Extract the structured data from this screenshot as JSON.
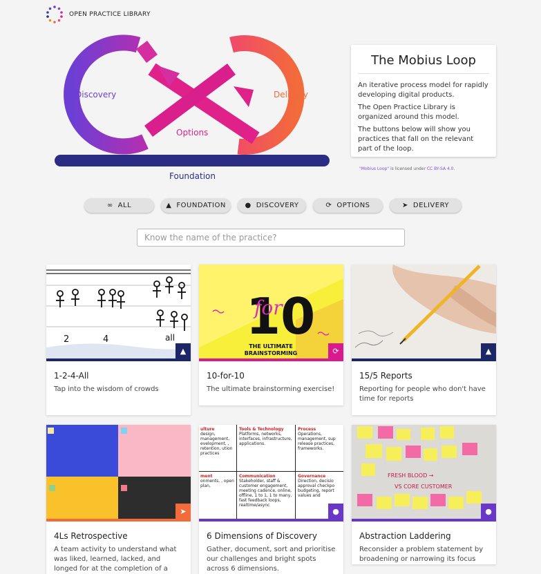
{
  "header": {
    "brand": "OPEN PRACTICE LIBRARY"
  },
  "loop": {
    "discovery_label": "Discovery",
    "delivery_label": "Delivery",
    "options_label": "Options",
    "foundation_label": "Foundation"
  },
  "info": {
    "title": "The Mobius Loop",
    "p1": "An iterative process model for rapidly developing digital products.",
    "p2": "The Open Practice Library is organized around this model.",
    "p3": "The buttons below will show you practices that fall on the relevant part of the loop.",
    "license_link": "\"Mobius Loop\"",
    "license_mid": " is licensed under ",
    "license_cc": "CC BY-SA 4.0."
  },
  "filters": [
    {
      "label": "ALL",
      "icon": "infinity-icon",
      "glyph": "∞"
    },
    {
      "label": "FOUNDATION",
      "icon": "mountain-icon",
      "glyph": "▲"
    },
    {
      "label": "DISCOVERY",
      "icon": "compass-icon",
      "glyph": "●"
    },
    {
      "label": "OPTIONS",
      "icon": "sync-icon",
      "glyph": "⟳"
    },
    {
      "label": "DELIVERY",
      "icon": "paper-plane-icon",
      "glyph": "➤"
    }
  ],
  "search": {
    "placeholder": "Know the name of the practice?"
  },
  "cards": [
    {
      "title": "1-2-4-All",
      "desc": "Tap into the wisdom of crowds",
      "badge": "mountain-icon"
    },
    {
      "title": "10-for-10",
      "desc": "The ultimate brainstorming exercise!",
      "badge": "sync-icon",
      "img_big": "10",
      "img_for": "for",
      "img_sub1": "THE ULTIMATE",
      "img_sub2": "BRAINSTORMING"
    },
    {
      "title": "15/5 Reports",
      "desc": "Reporting for people who don't have time for reports",
      "badge": "mountain-icon"
    },
    {
      "title": "4Ls Retrospective",
      "desc": "A team activity to understand what was liked, learned, lacked, and longed for at the completion of a",
      "badge": "paper-plane-icon"
    },
    {
      "title": "6 Dimensions of Discovery",
      "desc": "Gather, document, sort and prioritise our challenges and bright spots across 6 dimensions.",
      "badge": "compass-icon",
      "grid": [
        {
          "h": "ulture",
          "t": "design, management, evelopment, , retention, ution practices"
        },
        {
          "h": "Tools & Technology",
          "t": "Platforms, networks, interfaces, infrastructure, applications."
        },
        {
          "h": "Process",
          "t": "Operations, management, sup release practices, frameworks."
        },
        {
          "h": "ment",
          "t": "onments, , open plan,"
        },
        {
          "h": "Communication",
          "t": "Stakeholder, staff & customer engagement, meeting cadence, online, offline, 1 to 1, 1 to many, fast feedback loops, realtime/async"
        },
        {
          "h": "Governance",
          "t": "Direction, decisio approval checkpo budgeting, report values and"
        }
      ]
    },
    {
      "title": "Abstraction Laddering",
      "desc": "Reconsider a problem statement by broadening or narrowing its focus",
      "badge": "compass-icon",
      "note1": "FRESH BLOOD →",
      "note2": "VS CORE CUSTOMER"
    }
  ],
  "colors": {
    "discovery": "#6b3fd4",
    "delivery": "#f26b3a",
    "options": "#e0218a",
    "foundation": "#2b2d84",
    "badge_foundation": "#1d2667",
    "badge_options": "#d91a8f",
    "badge_delivery": "#f26b3a",
    "badge_discovery": "#6a38c8"
  }
}
